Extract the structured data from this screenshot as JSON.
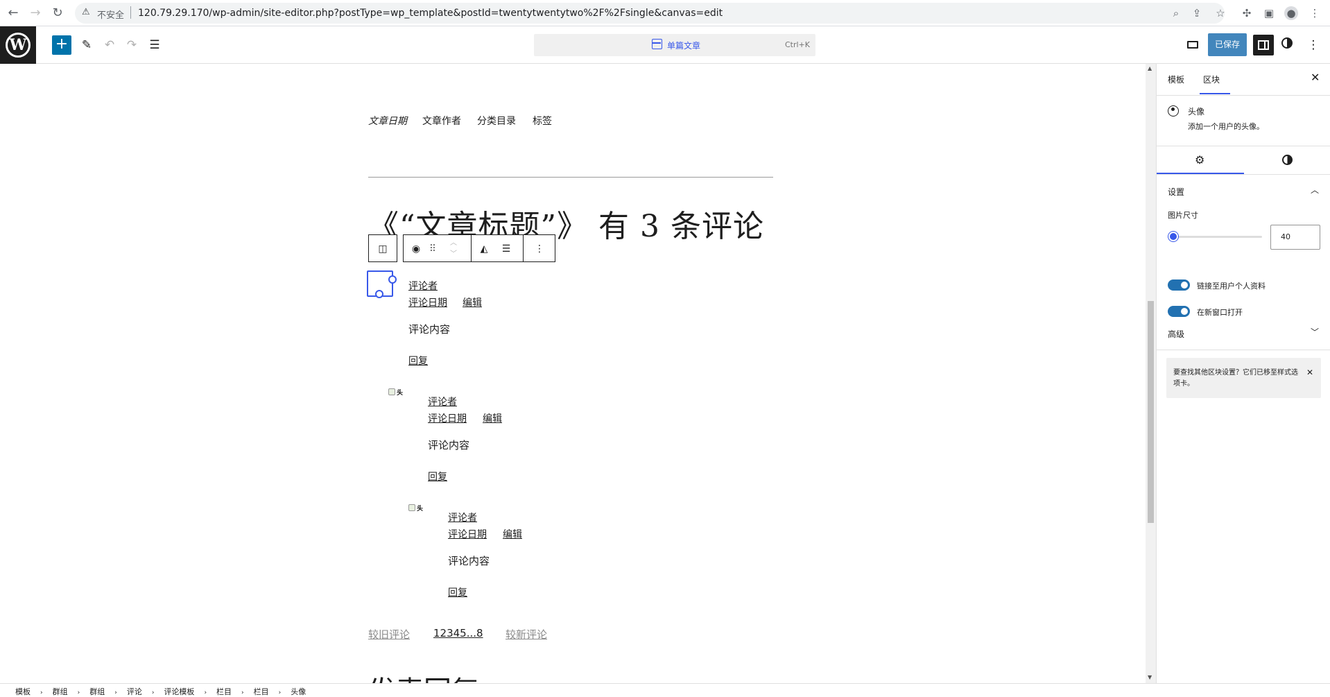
{
  "browser": {
    "url_warning_icon": "warning-icon",
    "insecure_label": "不安全",
    "url": "120.79.29.170/wp-admin/site-editor.php?postType=wp_template&postId=twentytwentytwo%2F%2Fsingle&canvas=edit"
  },
  "header": {
    "command_title": "单篇文章",
    "command_shortcut": "Ctrl+K",
    "save_label": "已保存"
  },
  "canvas": {
    "post_meta": [
      "文章日期",
      "文章作者",
      "分类目录",
      "标签"
    ],
    "comments_title": "《“文章标题”》 有 3 条评论",
    "comments": [
      {
        "author": "评论者",
        "date": "评论日期",
        "edit": "编辑",
        "content": "评论内容",
        "reply": "回复"
      },
      {
        "author": "评论者",
        "date": "评论日期",
        "edit": "编辑",
        "content": "评论内容",
        "reply": "回复"
      },
      {
        "author": "评论者",
        "date": "评论日期",
        "edit": "编辑",
        "content": "评论内容",
        "reply": "回复"
      }
    ],
    "broken_avatar_alt": "头像",
    "pagination": {
      "older": "较旧评论",
      "numbers": "12345...8",
      "newer": "较新评论"
    },
    "reply_heading": "发表回复"
  },
  "sidebar": {
    "tabs": [
      "模板",
      "区块"
    ],
    "block_name": "头像",
    "block_description": "添加一个用户的头像。",
    "settings_panel_title": "设置",
    "image_size_label": "图片尺寸",
    "image_size_value": "40",
    "image_size_fraction": 0.06,
    "toggle_link_profile": "链接至用户个人资料",
    "toggle_new_window": "在新窗口打开",
    "advanced_panel_title": "高级",
    "notice_text": "要查找其他区块设置？它们已移至样式选项卡。"
  },
  "breadcrumbs": [
    "模板",
    "群组",
    "群组",
    "评论",
    "评论模板",
    "栏目",
    "栏目",
    "头像"
  ],
  "colors": {
    "accent": "#3858e9",
    "save_button": "#2271b1",
    "dark": "#1e1e1e"
  }
}
